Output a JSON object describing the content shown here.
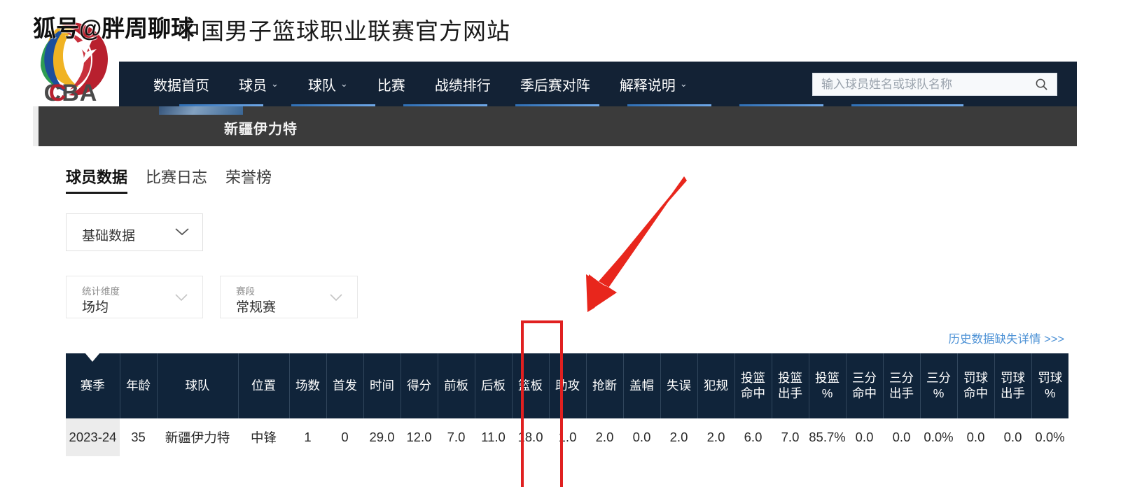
{
  "site": {
    "title": "中国男子篮球职业联赛官方网站",
    "watermark": "搜狐号@胖周聊球",
    "logo_text": "CBA"
  },
  "nav": {
    "items": [
      {
        "label": "数据首页",
        "has_dropdown": false
      },
      {
        "label": "球员",
        "has_dropdown": true
      },
      {
        "label": "球队",
        "has_dropdown": true
      },
      {
        "label": "比赛",
        "has_dropdown": false
      },
      {
        "label": "战绩排行",
        "has_dropdown": false
      },
      {
        "label": "季后赛对阵",
        "has_dropdown": false
      },
      {
        "label": "解释说明",
        "has_dropdown": true
      }
    ],
    "caret": "⌄"
  },
  "search": {
    "placeholder": "输入球员姓名或球队名称",
    "value": "",
    "icon": "search-icon"
  },
  "team_banner": {
    "team_name": "新疆伊力特"
  },
  "tabs": [
    {
      "label": "球员数据",
      "active": true
    },
    {
      "label": "比赛日志",
      "active": false
    },
    {
      "label": "荣誉榜",
      "active": false
    }
  ],
  "filters": {
    "data_type": {
      "value": "基础数据"
    },
    "dimension": {
      "label": "统计维度",
      "value": "场均"
    },
    "stage": {
      "label": "赛段",
      "value": "常规赛"
    }
  },
  "history_link": {
    "label": "历史数据缺失详情 >>>"
  },
  "table": {
    "sorted_column": "赛季",
    "headers": [
      {
        "line1": "赛季",
        "line2": ""
      },
      {
        "line1": "年龄",
        "line2": ""
      },
      {
        "line1": "球队",
        "line2": ""
      },
      {
        "line1": "位置",
        "line2": ""
      },
      {
        "line1": "场数",
        "line2": ""
      },
      {
        "line1": "首发",
        "line2": ""
      },
      {
        "line1": "时间",
        "line2": ""
      },
      {
        "line1": "得分",
        "line2": ""
      },
      {
        "line1": "前板",
        "line2": ""
      },
      {
        "line1": "后板",
        "line2": ""
      },
      {
        "line1": "篮板",
        "line2": ""
      },
      {
        "line1": "助攻",
        "line2": ""
      },
      {
        "line1": "抢断",
        "line2": ""
      },
      {
        "line1": "盖帽",
        "line2": ""
      },
      {
        "line1": "失误",
        "line2": ""
      },
      {
        "line1": "犯规",
        "line2": ""
      },
      {
        "line1": "投篮",
        "line2": "命中"
      },
      {
        "line1": "投篮",
        "line2": "出手"
      },
      {
        "line1": "投篮",
        "line2": "%"
      },
      {
        "line1": "三分",
        "line2": "命中"
      },
      {
        "line1": "三分",
        "line2": "出手"
      },
      {
        "line1": "三分",
        "line2": "%"
      },
      {
        "line1": "罚球",
        "line2": "命中"
      },
      {
        "line1": "罚球",
        "line2": "出手"
      },
      {
        "line1": "罚球",
        "line2": "%"
      }
    ],
    "rows": [
      {
        "cells": [
          "2023-24",
          "35",
          "新疆伊力特",
          "中锋",
          "1",
          "0",
          "29.0",
          "12.0",
          "7.0",
          "11.0",
          "18.0",
          "1.0",
          "2.0",
          "0.0",
          "2.0",
          "2.0",
          "6.0",
          "7.0",
          "85.7%",
          "0.0",
          "0.0",
          "0.0%",
          "0.0",
          "0.0",
          "0.0%"
        ]
      }
    ]
  },
  "annotations": {
    "highlight_column": "篮板",
    "highlight_color": "#e02020"
  }
}
